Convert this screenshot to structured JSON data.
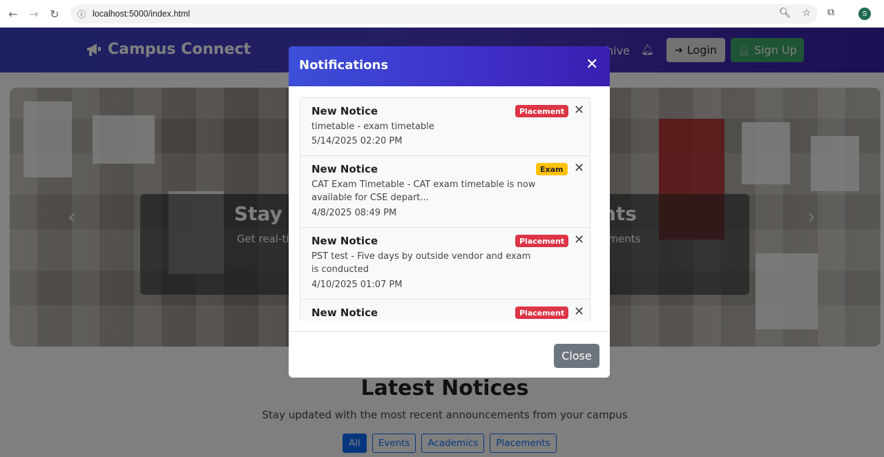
{
  "browser": {
    "url": "localhost:5000/index.html",
    "profile_initial": "S"
  },
  "navbar": {
    "brand": "Campus Connect",
    "partial_link": "hive",
    "login_label": "Login",
    "signup_label": "Sign Up"
  },
  "hero": {
    "title_left": "Stay U",
    "title_right": "ents",
    "subtitle_left": "Get real-ti",
    "subtitle_right": "cements"
  },
  "notices": {
    "title": "Latest Notices",
    "subtitle": "Stay updated with the most recent announcements from your campus",
    "filters": [
      "All",
      "Events",
      "Academics",
      "Placements"
    ]
  },
  "modal": {
    "title": "Notifications",
    "close_label": "Close",
    "items": [
      {
        "title": "New Notice",
        "badge": "Placement",
        "desc": "timetable - exam timetable",
        "date": "5/14/2025 02:20 PM"
      },
      {
        "title": "New Notice",
        "badge": "Exam",
        "desc": "CAT Exam Timetable - CAT exam timetable is now available for CSE depart...",
        "date": "4/8/2025 08:49 PM"
      },
      {
        "title": "New Notice",
        "badge": "Placement",
        "desc": "PST test - Five days by outside vendor and exam is conducted",
        "date": "4/10/2025 01:07 PM"
      },
      {
        "title": "New Notice",
        "badge": "Placement",
        "desc": "",
        "date": ""
      }
    ]
  },
  "colors": {
    "nav_gradient_start": "#3a3fc2",
    "nav_gradient_end": "#3a1fa6",
    "placement_badge": "#dc3545",
    "exam_badge": "#ffc107",
    "signup_green": "#3fa66b",
    "filter_blue": "#0d6efd"
  }
}
